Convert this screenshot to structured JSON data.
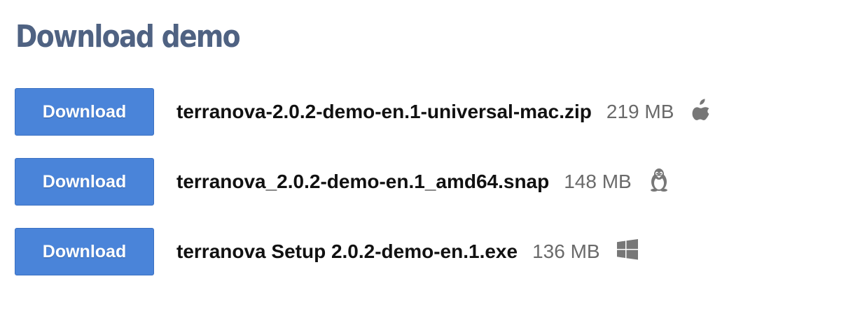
{
  "page": {
    "title": "Download demo"
  },
  "downloads": [
    {
      "button_label": "Download",
      "file_name": "terranova-2.0.2-demo-en.1-universal-mac.zip",
      "file_size": "219 MB",
      "os_icon": "apple-icon"
    },
    {
      "button_label": "Download",
      "file_name": "terranova_2.0.2-demo-en.1_amd64.snap",
      "file_size": "148 MB",
      "os_icon": "linux-icon"
    },
    {
      "button_label": "Download",
      "file_name": "terranova Setup 2.0.2-demo-en.1.exe",
      "file_size": "136 MB",
      "os_icon": "windows-icon"
    }
  ],
  "colors": {
    "title": "#4f6282",
    "button": "#4a84d9",
    "file_size": "#6a6a6a",
    "icon": "#777777"
  }
}
